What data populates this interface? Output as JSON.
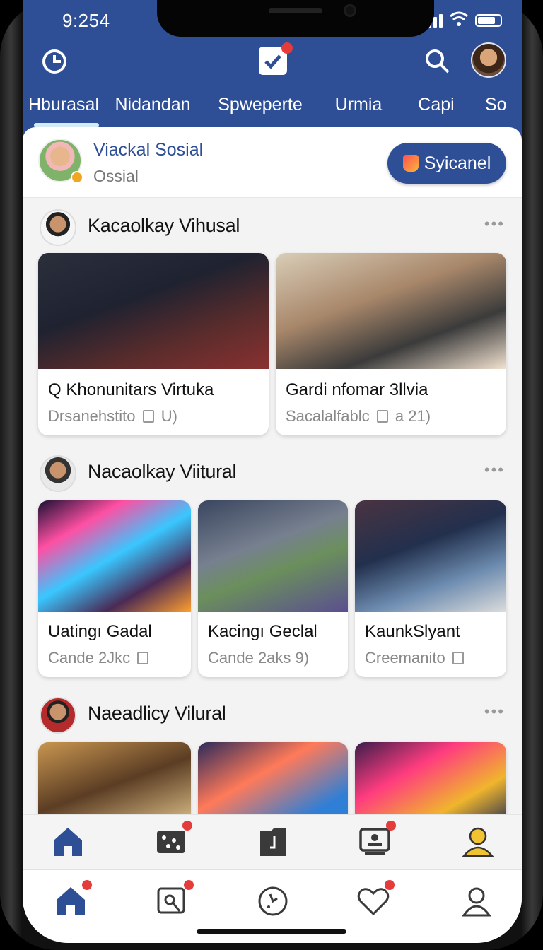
{
  "status": {
    "time": "9:254"
  },
  "tabs": [
    "Hburasal",
    "Nidandan",
    "Spweperte",
    "Urmia",
    "Capi",
    "So"
  ],
  "profile": {
    "name": "Viackal Sosial",
    "subtitle": "Ossial",
    "button_label": "Syicanel"
  },
  "sections": [
    {
      "title": "Kacaolkay Vihusal",
      "more": "•••",
      "cards": [
        {
          "title": "Q Khonunitars Virtuka",
          "subtitle": "Drsanehstito",
          "subtitle_suffix": "U)"
        },
        {
          "title": "Gardi nfomar 3llvia",
          "subtitle": "Sacalalfablc",
          "subtitle_suffix": "a 21)"
        }
      ]
    },
    {
      "title": "Nacaolkay Viitural",
      "more": "•••",
      "cards": [
        {
          "title": "Uatingı Gadal",
          "subtitle": "Cande 2Jkc",
          "subtitle_suffix": ""
        },
        {
          "title": "Kacingı Geclal",
          "subtitle": "Cande 2aks 9)",
          "subtitle_suffix": ""
        },
        {
          "title": "KaunkSlyant",
          "subtitle": "Creemanito",
          "subtitle_suffix": ""
        }
      ]
    },
    {
      "title": "Naeadlicy Vilural",
      "more": "•••"
    }
  ],
  "colors": {
    "brand": "#2e4e96",
    "badge": "#e53b3b",
    "background": "#f3f3f3",
    "active_profile_icon": "#f1c232"
  },
  "nav_top": [
    "home-icon",
    "gallery-icon",
    "music-icon",
    "video-icon",
    "profile-icon"
  ],
  "nav_bottom": [
    "home-icon",
    "search-icon",
    "clock-icon",
    "heart-icon",
    "user-icon"
  ]
}
